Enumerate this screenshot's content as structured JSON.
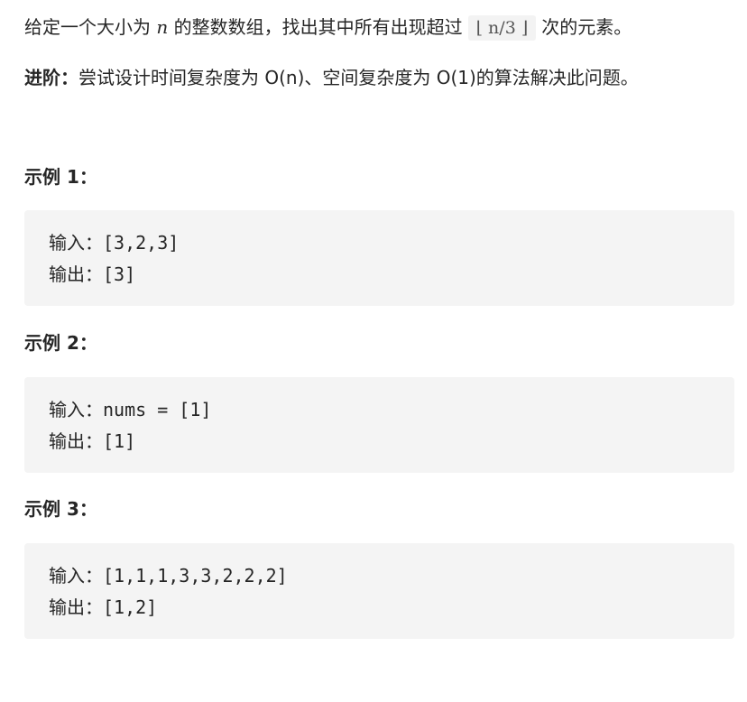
{
  "description": {
    "line1_before": "给定一个大小为 ",
    "var_n": "n",
    "line1_middle": " 的整数数组，找出其中所有出现超过",
    "math": "⌊ n/3 ⌋",
    "line1_after": "次的元素。",
    "advanced_label": "进阶：",
    "advanced_text": "尝试设计时间复杂度为 O(n)、空间复杂度为 O(1)的算法解决此问题。"
  },
  "examples": [
    {
      "title": "示例 1：",
      "input_label": "输入：",
      "input_value": "[3,2,3]",
      "output_label": "输出：",
      "output_value": "[3]"
    },
    {
      "title": "示例 2：",
      "input_label": "输入：",
      "input_value": "nums = [1]",
      "output_label": "输出：",
      "output_value": "[1]"
    },
    {
      "title": "示例 3：",
      "input_label": "输入：",
      "input_value": "[1,1,1,3,3,2,2,2]",
      "output_label": "输出：",
      "output_value": "[1,2]"
    }
  ]
}
